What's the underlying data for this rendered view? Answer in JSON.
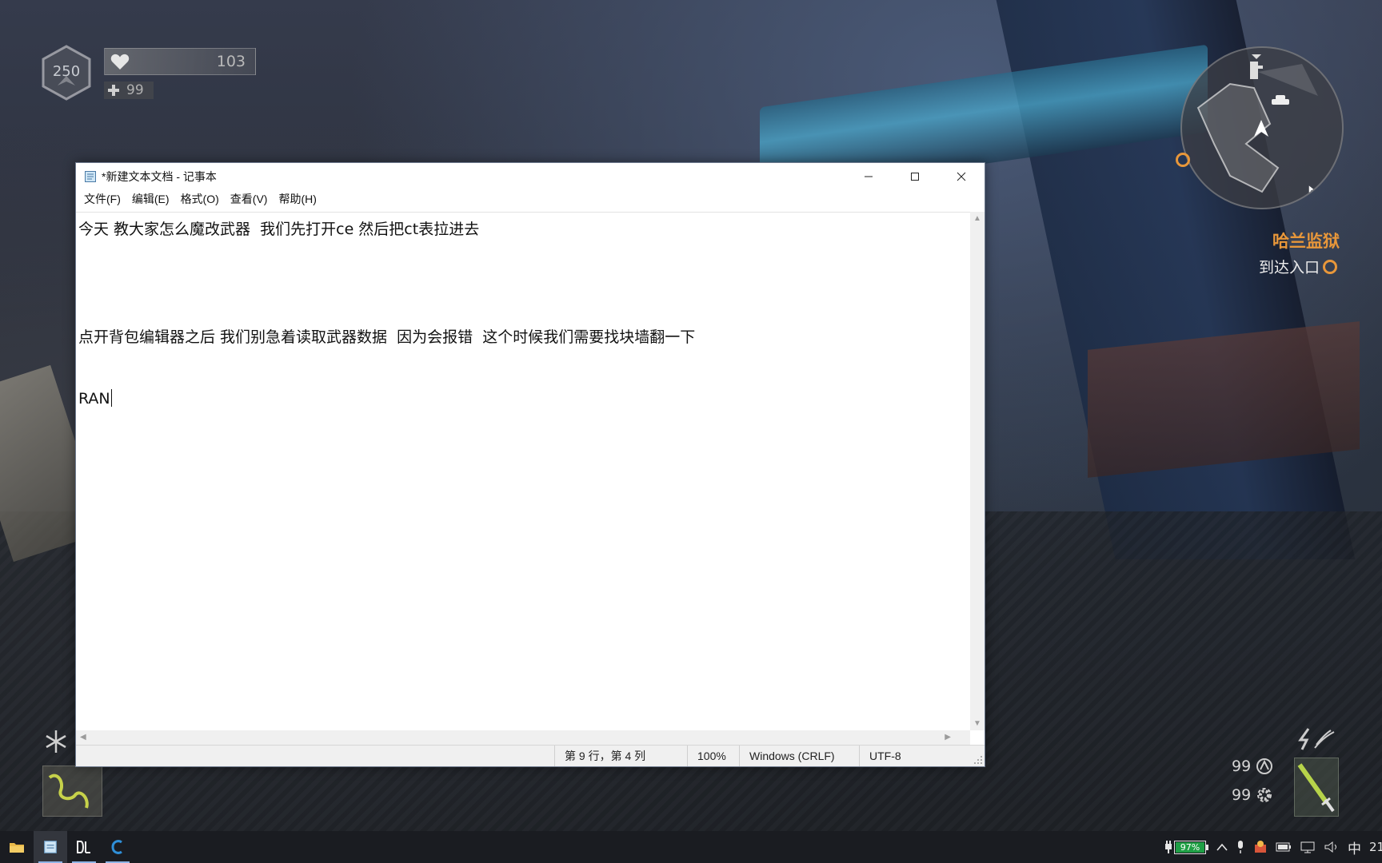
{
  "hud": {
    "level": "250",
    "health": "103",
    "medkits": "99",
    "map_title": "哈兰监狱",
    "objective": "到达入口",
    "ammo_1": "99",
    "ammo_2": "99"
  },
  "notepad": {
    "title": "*新建文本文档 - 记事本",
    "menu": [
      "文件(F)",
      "编辑(E)",
      "格式(O)",
      "查看(V)",
      "帮助(H)"
    ],
    "lines": [
      "今天 教大家怎么魔改武器  我们先打开ce 然后把ct表拉进去",
      "点开背包编辑器之后 我们别急着读取武器数据  因为会报错  这个时候我们需要找块墙翻一下",
      "RAN"
    ],
    "status": {
      "position": "第 9 行，第 4 列",
      "zoom": "100%",
      "line_ending": "Windows (CRLF)",
      "encoding": "UTF-8"
    }
  },
  "taskbar": {
    "battery": "97%",
    "ime": "中",
    "clock": "21"
  },
  "colors": {
    "accent_orange": "#e8973a",
    "battery_green": "#1f9f45"
  }
}
